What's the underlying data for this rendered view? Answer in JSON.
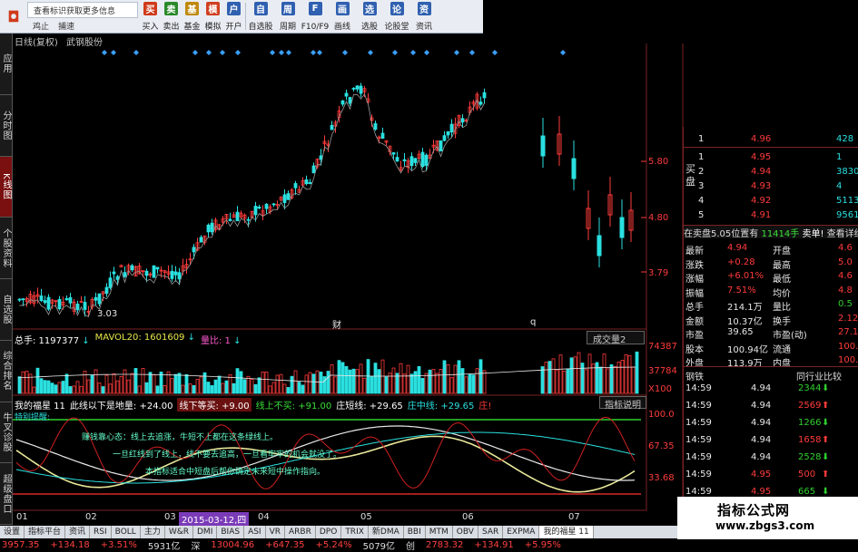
{
  "toolbar": {
    "info_text": "查看标识获取更多信息",
    "small_links": [
      "鸡止",
      "捕速"
    ],
    "buttons": [
      {
        "label": "买入",
        "color": "#d03a1a",
        "glyph": "买"
      },
      {
        "label": "卖出",
        "color": "#2a8a2a",
        "glyph": "卖"
      },
      {
        "label": "基金",
        "color": "#c08a10",
        "glyph": "基"
      },
      {
        "label": "模拟",
        "color": "#d04020",
        "glyph": "模"
      },
      {
        "label": "开户",
        "color": "#3060b0",
        "glyph": "户"
      },
      {
        "label": "自选股",
        "color": "#3060b0",
        "glyph": "自"
      },
      {
        "label": "周期",
        "color": "#3060b0",
        "glyph": "周"
      },
      {
        "label": "F10/F9",
        "color": "#3060b0",
        "glyph": "F"
      },
      {
        "label": "画线",
        "color": "#3060b0",
        "glyph": "画"
      },
      {
        "label": "选股",
        "color": "#3060b0",
        "glyph": "选"
      },
      {
        "label": "论股堂",
        "color": "#3060b0",
        "glyph": "论"
      },
      {
        "label": "资讯",
        "color": "#3060b0",
        "glyph": "资"
      }
    ]
  },
  "vertical_tabs": [
    "应用",
    "分时图",
    "K线图",
    "个股资料",
    "自选股",
    "综合排名",
    "牛叉诊股",
    "超级盘口"
  ],
  "chart_header": {
    "period": "日线(复权)",
    "stock_name": "武钢股份"
  },
  "price_axis_labels": [
    "5.80",
    "4.80",
    "3.79"
  ],
  "price_low_label": "3.03",
  "chart_markers": [
    "财",
    "q"
  ],
  "volume": {
    "total_label": "总手: 1197377",
    "mavol_label": "MAVOL20: 1601609",
    "ratio_label": "量比: 1",
    "dropdown_label": "成交量2",
    "axis_labels": [
      "74387",
      "37784",
      "X100"
    ]
  },
  "indicator": {
    "name": "我的福星 11",
    "line1": "此线以下是地量: +24.00",
    "line2": "线下等买: +9.00",
    "line3": "线上不买: +91.00",
    "line4": "庄短线: +29.65",
    "line5": "庄中线: +29.65",
    "line6": "庄!",
    "explain_button": "指标说明",
    "sub_label": "特别提醒:",
    "texts": [
      "赚钱靠心态：线上去追涨，牛短不上都在这条绿线上。",
      "一旦红线到了线上，线不要去追高，一旦看牢牢的机会就没了。",
      "本指标适合中短盘后帮你确定未来短中操作指向。"
    ],
    "axis_labels": [
      "100.0",
      "67.35",
      "33.68"
    ]
  },
  "date_axis": {
    "labels": [
      "01",
      "02",
      "03",
      "04",
      "05",
      "06",
      "07"
    ],
    "highlight": "2015-03-12,四"
  },
  "bottom_tabs": [
    "设置",
    "指标平台",
    "资讯",
    "RSI",
    "BOLL",
    "主力",
    "W&R",
    "DMI",
    "BIAS",
    "ASI",
    "VR",
    "ARBR",
    "DPO",
    "TRIX",
    "新DMA",
    "BBI",
    "MTM",
    "OBV",
    "SAR",
    "EXPMA",
    "我的福星 11"
  ],
  "status_bar": [
    "3957.35",
    "+134.18",
    "+3.51%",
    "5931亿",
    "深",
    "13004.96",
    "+647.35",
    "+5.24%",
    "5079亿",
    "创",
    "2783.32",
    "+134.91",
    "+5.95%"
  ],
  "order_book": {
    "sell_label": "卖盘",
    "buy_label": "买盘",
    "sell": [
      {
        "lvl": "1",
        "price": "4.96",
        "vol": "428"
      }
    ],
    "buy": [
      {
        "lvl": "1",
        "price": "4.95",
        "vol": "1"
      },
      {
        "lvl": "2",
        "price": "4.94",
        "vol": "3830"
      },
      {
        "lvl": "3",
        "price": "4.93",
        "vol": "4"
      },
      {
        "lvl": "4",
        "price": "4.92",
        "vol": "5113"
      },
      {
        "lvl": "5",
        "price": "4.91",
        "vol": "9561"
      }
    ],
    "banner_a": "在卖盘5.05位置有",
    "banner_b": "11414手",
    "banner_c": "卖单!",
    "banner_d": "查看详细"
  },
  "quote_stats": [
    {
      "k1": "最新",
      "v1": "4.94",
      "k2": "开盘",
      "v2": "4.6"
    },
    {
      "k1": "涨跌",
      "v1": "+0.28",
      "k2": "最高",
      "v2": "5.0"
    },
    {
      "k1": "涨幅",
      "v1": "+6.01%",
      "k2": "最低",
      "v2": "4.6"
    },
    {
      "k1": "振幅",
      "v1": "7.51%",
      "k2": "均价",
      "v2": "4.8"
    },
    {
      "k1": "总手",
      "v1": "214.1万",
      "k2": "量比",
      "v2": "0.5"
    },
    {
      "k1": "金额",
      "v1": "10.37亿",
      "k2": "换手",
      "v2": "2.12"
    },
    {
      "k1": "市盈",
      "v1": "39.65",
      "k2": "市盈(动)",
      "v2": "27.1"
    },
    {
      "k1": "股本",
      "v1": "100.94亿",
      "k2": "流通",
      "v2": "100.94"
    },
    {
      "k1": "外盘",
      "v1": "113.9万",
      "k2": "内盘",
      "v2": "100.2"
    }
  ],
  "tick_header": {
    "left": "钢铁",
    "right": "同行业比较"
  },
  "ticks": [
    {
      "time": "14:59",
      "price": "4.94",
      "vol": "2344"
    },
    {
      "time": "14:59",
      "price": "4.94",
      "vol": "2569"
    },
    {
      "time": "14:59",
      "price": "4.94",
      "vol": "1266"
    },
    {
      "time": "14:59",
      "price": "4.94",
      "vol": "1658"
    },
    {
      "time": "14:59",
      "price": "4.94",
      "vol": "2528"
    },
    {
      "time": "14:59",
      "price": "4.95",
      "vol": "500"
    },
    {
      "time": "14:59",
      "price": "4.95",
      "vol": "665"
    }
  ],
  "watermark": {
    "line1": "指标公式网",
    "line2": "www.zbgs3.com"
  },
  "colors": {
    "up": "#ff3b3b",
    "down": "#2ae0e0",
    "grid": "#7a2222",
    "ma": "#e8e8e8"
  }
}
